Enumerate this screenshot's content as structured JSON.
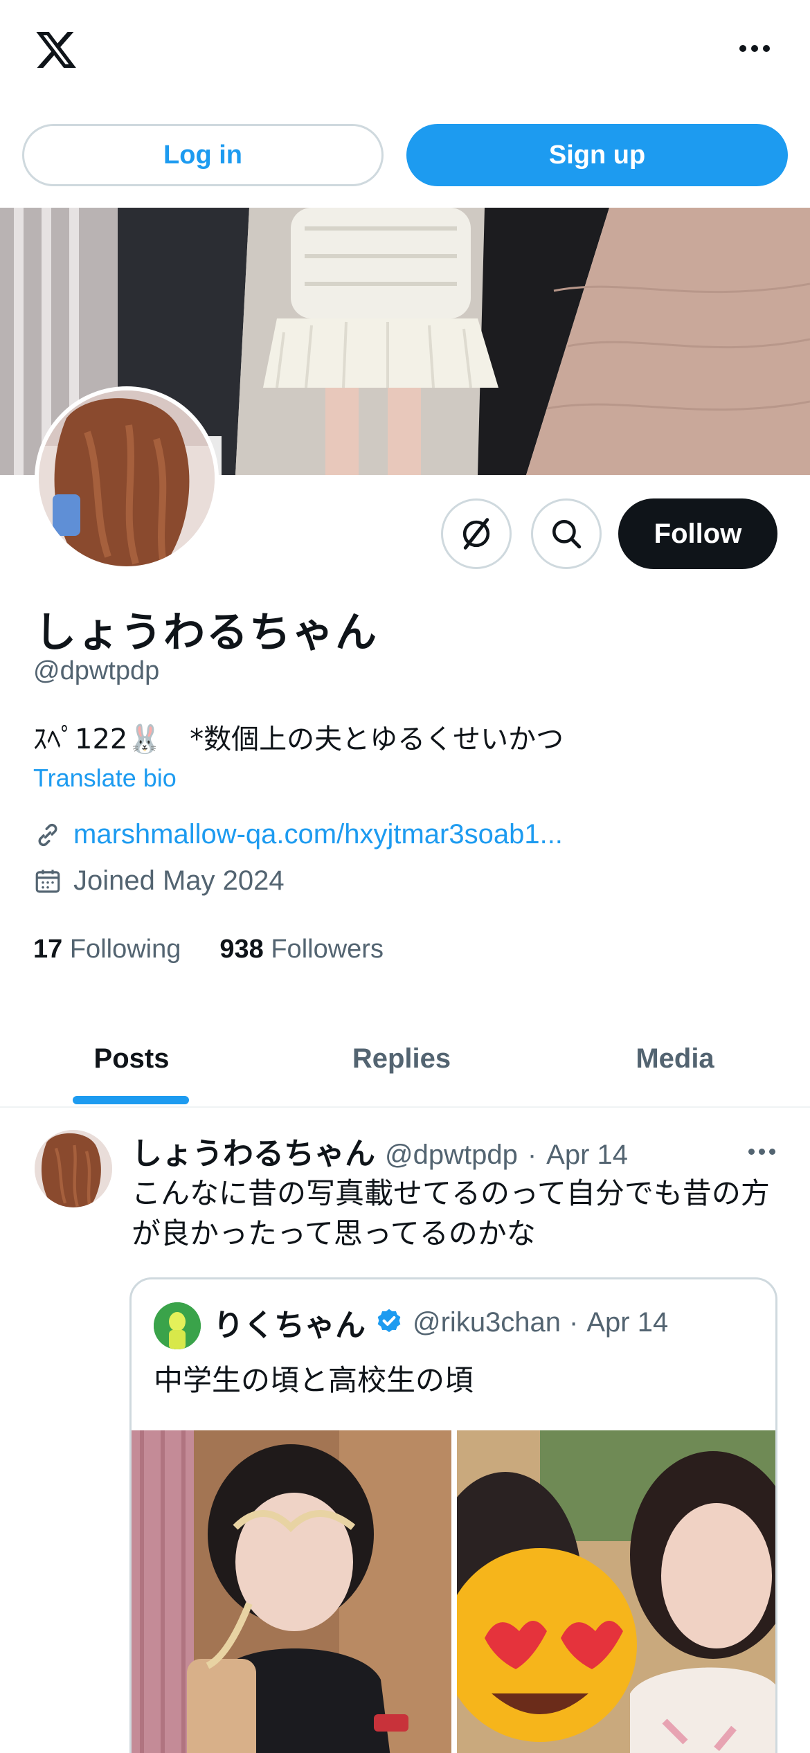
{
  "topbar": {
    "logo_icon": "x-logo-icon",
    "more_icon": "more-horizontal-icon"
  },
  "auth": {
    "login_label": "Log in",
    "signup_label": "Sign up"
  },
  "profile": {
    "display_name": "しょうわるちゃん",
    "handle": "@dpwtpdp",
    "bio": "ｽﾍﾟ122🐰　*数個上の夫とゆるくせいかつ",
    "translate_label": "Translate bio",
    "link": "marshmallow-qa.com/hxyjtmar3soab1...",
    "joined": "Joined May 2024",
    "following_count": "17",
    "following_label": "Following",
    "followers_count": "938",
    "followers_label": "Followers",
    "follow_label": "Follow"
  },
  "tabs": [
    {
      "label": "Posts",
      "active": true
    },
    {
      "label": "Replies",
      "active": false
    },
    {
      "label": "Media",
      "active": false
    }
  ],
  "post": {
    "name": "しょうわるちゃん",
    "handle": "@dpwtpdp",
    "separator": "·",
    "date": "Apr 14",
    "text": "こんなに昔の写真載せてるのって自分でも昔の方が良かったって思ってるのかな",
    "quote": {
      "name": "りくちゃん",
      "verified": true,
      "handle": "@riku3chan",
      "separator": "·",
      "date": "Apr 14",
      "text": "中学生の頃と高校生の頃"
    }
  },
  "colors": {
    "accent": "#1d9bf0",
    "text": "#0f1419",
    "muted": "#536471",
    "border": "#cfd9de"
  }
}
